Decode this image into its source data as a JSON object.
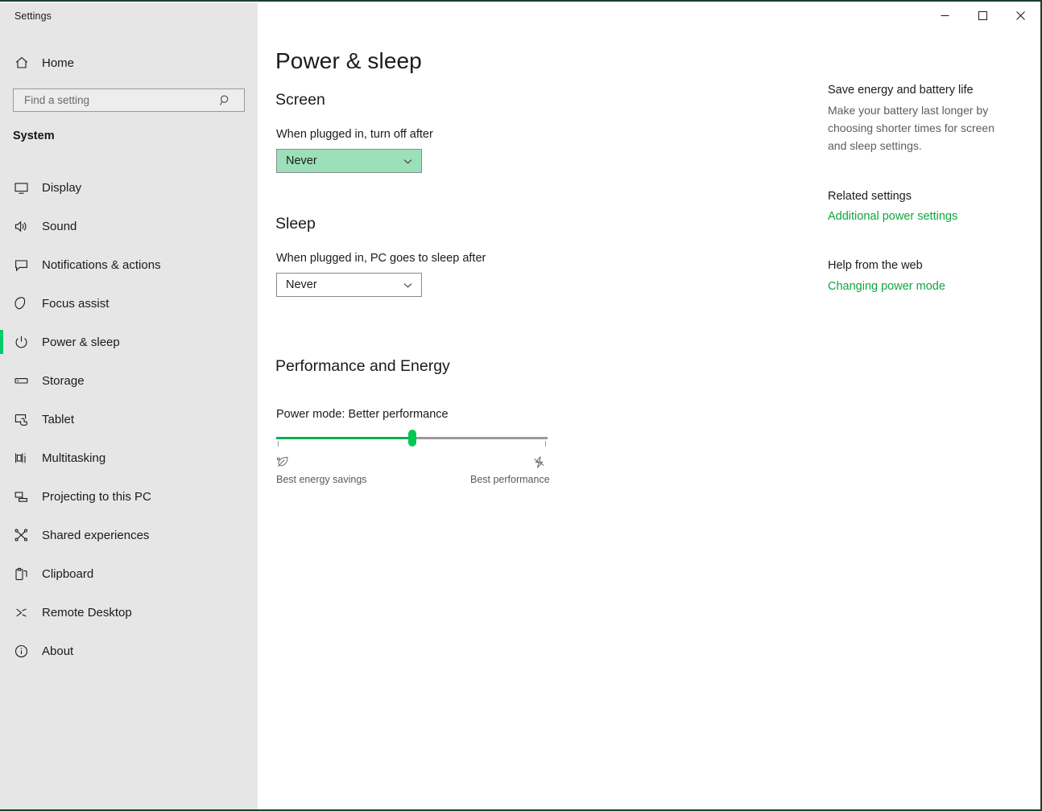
{
  "window": {
    "app_title": "Settings",
    "border_color": "#19402f",
    "caption_buttons": [
      {
        "name": "minimize-button",
        "glyph": "minimize-icon"
      },
      {
        "name": "maximize-button",
        "glyph": "maximize-icon"
      },
      {
        "name": "close-button",
        "glyph": "close-icon"
      }
    ]
  },
  "sidebar": {
    "background": "#e6e6e6",
    "home": {
      "label": "Home",
      "icon": "home-icon"
    },
    "search": {
      "placeholder": "Find a setting",
      "value": "",
      "icon": "search-icon"
    },
    "group_title": "System",
    "accent_color": "#00cc6a",
    "items": [
      {
        "label": "Display",
        "icon": "monitor-icon",
        "selected": false
      },
      {
        "label": "Sound",
        "icon": "speaker-icon",
        "selected": false
      },
      {
        "label": "Notifications & actions",
        "icon": "notification-icon",
        "selected": false
      },
      {
        "label": "Focus assist",
        "icon": "moon-icon",
        "selected": false
      },
      {
        "label": "Power & sleep",
        "icon": "power-icon",
        "selected": true
      },
      {
        "label": "Storage",
        "icon": "drive-icon",
        "selected": false
      },
      {
        "label": "Tablet",
        "icon": "tablet-icon",
        "selected": false
      },
      {
        "label": "Multitasking",
        "icon": "multitasking-icon",
        "selected": false
      },
      {
        "label": "Projecting to this PC",
        "icon": "project-screen-icon",
        "selected": false
      },
      {
        "label": "Shared experiences",
        "icon": "share-nodes-icon",
        "selected": false
      },
      {
        "label": "Clipboard",
        "icon": "clipboard-icon",
        "selected": false
      },
      {
        "label": "Remote Desktop",
        "icon": "remote-desktop-icon",
        "selected": false
      },
      {
        "label": "About",
        "icon": "info-icon",
        "selected": false
      }
    ]
  },
  "main": {
    "page_title": "Power & sleep",
    "screen": {
      "heading": "Screen",
      "field_label": "When plugged in, turn off after",
      "value": "Never",
      "highlight_color": "#9ce0b9",
      "highlighted": true
    },
    "sleep": {
      "heading": "Sleep",
      "field_label": "When plugged in, PC goes to sleep after",
      "value": "Never",
      "highlighted": false
    },
    "performance": {
      "heading": "Performance and Energy",
      "power_mode_label": "Power mode: Better performance",
      "slider": {
        "percent": 50,
        "fill_color": "#00b053",
        "thumb_color": "#00c853",
        "track_color": "#9a9a9a",
        "left_icon": "leaf-icon",
        "right_icon": "lightning-bolt-icon",
        "left_label": "Best energy savings",
        "right_label": "Best performance"
      }
    }
  },
  "right_pane": {
    "info_heading": "Save energy and battery life",
    "info_body": "Make your battery last longer by choosing shorter times for screen and sleep settings.",
    "related_heading": "Related settings",
    "related_link": "Additional power settings",
    "help_heading": "Help from the web",
    "help_link": "Changing power mode",
    "link_color": "#10a53f"
  }
}
